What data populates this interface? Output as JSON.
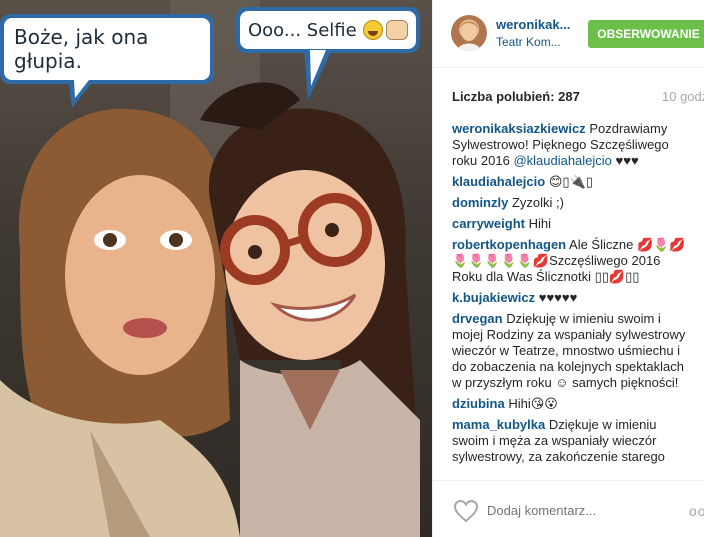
{
  "photo": {
    "bubble_left": "Boże, jak ona głupia.",
    "bubble_right": "Ooo... Selfie"
  },
  "post": {
    "username": "weronikak...",
    "location": "Teatr Kom...",
    "follow_label": "OBSERWOWANIE",
    "likes": "Liczba polubień: 287",
    "time": "10 godz",
    "add_comment_placeholder": "Dodaj komentarz...",
    "more": "ooo"
  },
  "comments": [
    {
      "user": "weronikaksiazkiewicz",
      "text": "Pozdrawiamy Sylwestrowo! Pięknego Szczęśliwego roku 2016 ",
      "mention": "@klaudiahalejcio",
      "tail": " ♥♥♥"
    },
    {
      "user": "klaudiahalejcio",
      "text": "😊▯🔌▯"
    },
    {
      "user": "dominzly",
      "text": "Zyzolki ;)"
    },
    {
      "user": "carryweight",
      "text": "Hihi"
    },
    {
      "user": "robertkopenhagen",
      "text": "Ale Śliczne 💋🌷💋🌷🌷🌷🌷🌷💋Szczęśliwego 2016 Roku dla Was Ślicznotki ▯▯💋▯▯"
    },
    {
      "user": "k.bujakiewicz",
      "text": "♥♥♥♥♥"
    },
    {
      "user": "drvegan",
      "text": "Dziękuję w imieniu swoim i mojej Rodziny za wspaniały sylwestrowy wieczór w Teatrze, mnostwo uśmiechu i do zobaczenia na kolejnych spektaklach w przyszłym roku ☺ samych piękności!"
    },
    {
      "user": "dziubina",
      "text": "Hihi😘😮"
    },
    {
      "user": "mama_kubylka",
      "text": "Dziękuje w imieniu swoim i męża za wspaniały wieczór sylwestrowy, za zakończenie starego"
    }
  ]
}
